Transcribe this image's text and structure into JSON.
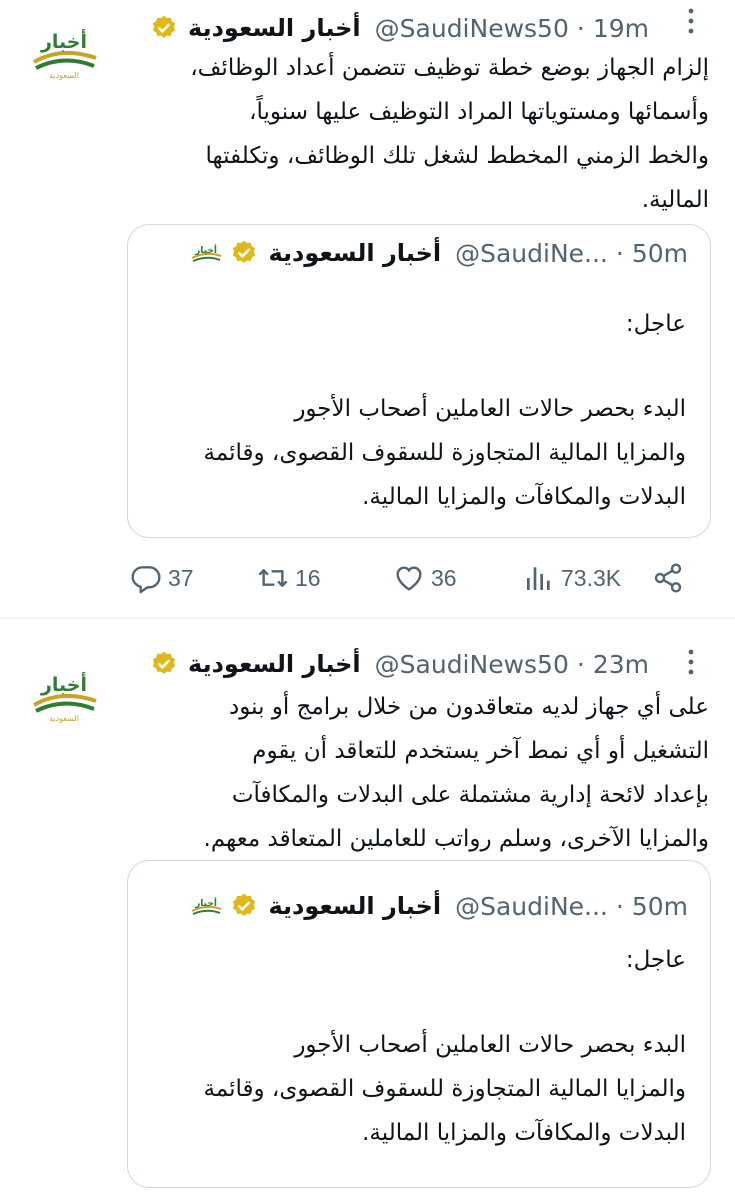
{
  "tweets": [
    {
      "author_name": "أخبار السعودية",
      "handle": "@SaudiNews50",
      "separator": "·",
      "time": "19m",
      "body": "إلزام الجهاز بوضع خطة توظيف تتضمن أعداد الوظائف،\nوأسمائها ومستوياتها المراد التوظيف عليها سنوياً،\nوالخط الزمني المخطط لشغل تلك الوظائف، وتكلفتها\nالمالية.",
      "quote": {
        "author_name": "أخبار السعودية",
        "handle": "@SaudiNe...",
        "separator": "·",
        "time": "50m",
        "label": "عاجل:",
        "body": "البدء بحصر حالات العاملين أصحاب الأجور\nوالمزايا المالية المتجاوزة للسقوف القصوى، وقائمة\nالبدلات والمكافآت والمزايا المالية."
      },
      "actions": {
        "replies": "37",
        "retweets": "16",
        "likes": "36",
        "views": "73.3K"
      }
    },
    {
      "author_name": "أخبار السعودية",
      "handle": "@SaudiNews50",
      "separator": "·",
      "time": "23m",
      "body": "على أي جهاز لديه متعاقدون من خلال برامج أو بنود\nالتشغيل أو أي نمط آخر يستخدم للتعاقد أن يقوم\nبإعداد لائحة إدارية مشتملة على البدلات والمكافآت\nوالمزايا الآخرى، وسلم رواتب للعاملين المتعاقد معهم.",
      "quote": {
        "author_name": "أخبار السعودية",
        "handle": "@SaudiNe...",
        "separator": "·",
        "time": "50m",
        "label": "عاجل:",
        "body": "البدء بحصر حالات العاملين أصحاب الأجور\nوالمزايا المالية المتجاوزة للسقوف القصوى، وقائمة\nالبدلات والمكافآت والمزايا المالية."
      }
    }
  ],
  "logo_text": "أخبار",
  "logo_subtext": "السعودية",
  "icons": {
    "more": "more-vertical-icon",
    "verified": "verified-badge-icon",
    "reply": "reply-icon",
    "retweet": "retweet-icon",
    "like": "heart-icon",
    "views": "views-icon",
    "share": "share-icon"
  },
  "colors": {
    "text": "#0f1419",
    "muted": "#536471",
    "border": "#cfd9de",
    "verified_gold": "#e2b719",
    "logo_green": "#2e7d32",
    "logo_gold": "#c9a227"
  }
}
